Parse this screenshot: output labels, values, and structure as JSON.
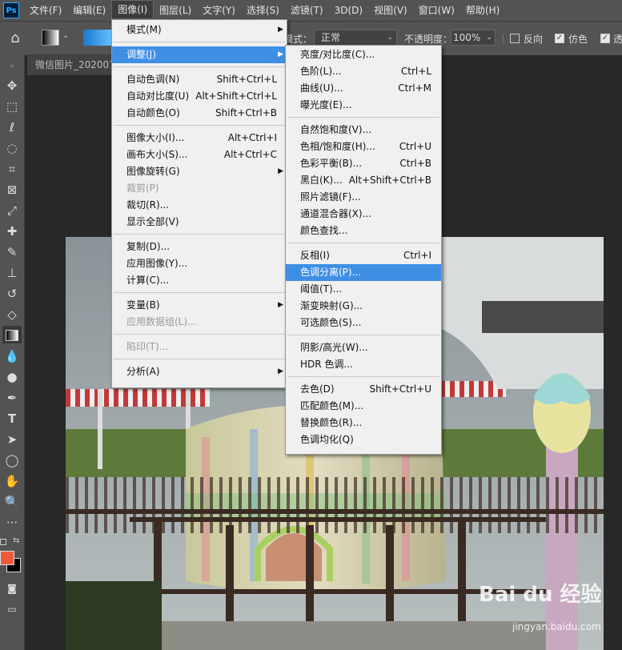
{
  "app": {
    "logo": "Ps",
    "accent": "#31a8ff"
  },
  "menubar": {
    "items": [
      "文件(F)",
      "编辑(E)",
      "图像(I)",
      "图层(L)",
      "文字(Y)",
      "选择(S)",
      "滤镜(T)",
      "3D(D)",
      "视图(V)",
      "窗口(W)",
      "帮助(H)"
    ],
    "active_index": 2
  },
  "options": {
    "mode_label": "模式：",
    "mode_value": "正常",
    "opacity_label": "不透明度：",
    "opacity_value": "100%",
    "reverse_label": "反向",
    "reverse_checked": false,
    "dither_label": "仿色",
    "dither_checked": true,
    "transparency_label": "透",
    "transparency_checked": true
  },
  "document": {
    "tab_title": "微信图片_202007"
  },
  "image_menu": {
    "items": [
      {
        "label": "模式(M)",
        "submenu": true
      },
      {
        "sep": true
      },
      {
        "label": "调整(J)",
        "submenu": true,
        "highlighted": true
      },
      {
        "sep": true
      },
      {
        "label": "自动色调(N)",
        "shortcut": "Shift+Ctrl+L"
      },
      {
        "label": "自动对比度(U)",
        "shortcut": "Alt+Shift+Ctrl+L"
      },
      {
        "label": "自动颜色(O)",
        "shortcut": "Shift+Ctrl+B"
      },
      {
        "sep": true
      },
      {
        "label": "图像大小(I)...",
        "shortcut": "Alt+Ctrl+I"
      },
      {
        "label": "画布大小(S)...",
        "shortcut": "Alt+Ctrl+C"
      },
      {
        "label": "图像旋转(G)",
        "submenu": true
      },
      {
        "label": "裁剪(P)",
        "disabled": true
      },
      {
        "label": "裁切(R)..."
      },
      {
        "label": "显示全部(V)"
      },
      {
        "sep": true
      },
      {
        "label": "复制(D)..."
      },
      {
        "label": "应用图像(Y)..."
      },
      {
        "label": "计算(C)..."
      },
      {
        "sep": true
      },
      {
        "label": "变量(B)",
        "submenu": true
      },
      {
        "label": "应用数据组(L)...",
        "disabled": true
      },
      {
        "sep": true
      },
      {
        "label": "陷印(T)...",
        "disabled": true
      },
      {
        "sep": true
      },
      {
        "label": "分析(A)",
        "submenu": true
      }
    ]
  },
  "adjust_menu": {
    "items": [
      {
        "label": "亮度/对比度(C)..."
      },
      {
        "label": "色阶(L)...",
        "shortcut": "Ctrl+L"
      },
      {
        "label": "曲线(U)...",
        "shortcut": "Ctrl+M"
      },
      {
        "label": "曝光度(E)..."
      },
      {
        "sep": true
      },
      {
        "label": "自然饱和度(V)..."
      },
      {
        "label": "色相/饱和度(H)...",
        "shortcut": "Ctrl+U"
      },
      {
        "label": "色彩平衡(B)...",
        "shortcut": "Ctrl+B"
      },
      {
        "label": "黑白(K)...",
        "shortcut": "Alt+Shift+Ctrl+B"
      },
      {
        "label": "照片滤镜(F)..."
      },
      {
        "label": "通道混合器(X)..."
      },
      {
        "label": "颜色查找..."
      },
      {
        "sep": true
      },
      {
        "label": "反相(I)",
        "shortcut": "Ctrl+I"
      },
      {
        "label": "色调分离(P)...",
        "highlighted": true
      },
      {
        "label": "阈值(T)..."
      },
      {
        "label": "渐变映射(G)..."
      },
      {
        "label": "可选颜色(S)..."
      },
      {
        "sep": true
      },
      {
        "label": "阴影/高光(W)..."
      },
      {
        "label": "HDR 色调..."
      },
      {
        "sep": true
      },
      {
        "label": "去色(D)",
        "shortcut": "Shift+Ctrl+U"
      },
      {
        "label": "匹配颜色(M)..."
      },
      {
        "label": "替换颜色(R)..."
      },
      {
        "label": "色调均化(Q)"
      }
    ]
  },
  "colors": {
    "foreground": "#f05a3c",
    "background": "#000000"
  },
  "watermark": {
    "brand": "Bai du 经验",
    "url": "jingyan.baidu.com"
  }
}
